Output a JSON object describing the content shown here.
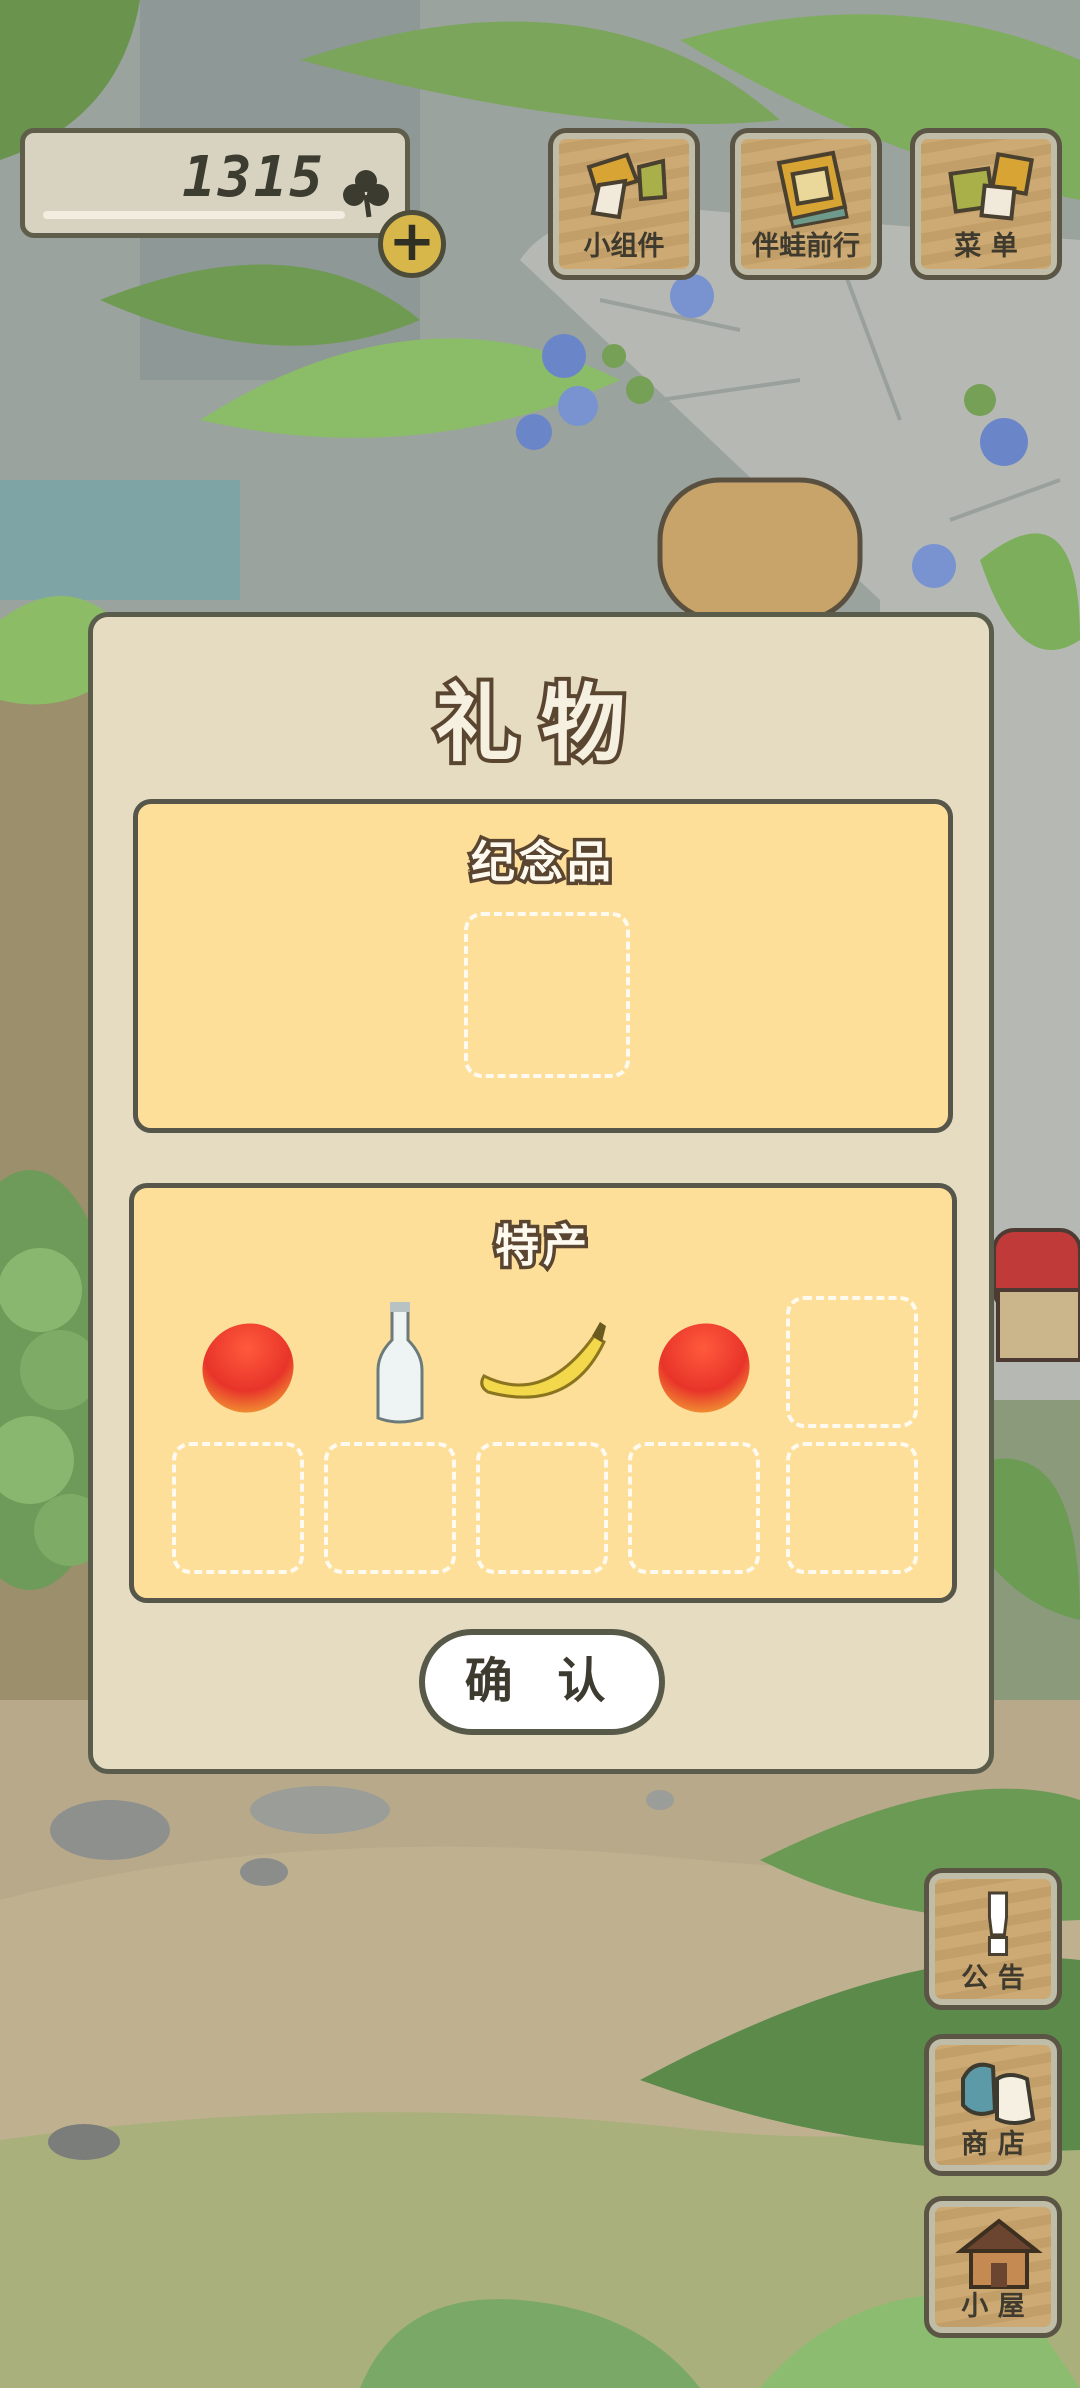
{
  "currency": {
    "amount": "1315",
    "icon": "clover-icon",
    "add_icon": "+"
  },
  "top_menu": {
    "widgets_label": "小组件",
    "travel_label": "伴蛙前行",
    "menu_label": "菜 单"
  },
  "side_menu": {
    "notice_label": "公 告",
    "shop_label": "商 店",
    "house_label": "小 屋",
    "notice_icon": "!"
  },
  "gift_dialog": {
    "title": "礼物",
    "souvenir": {
      "label": "纪念品",
      "items": []
    },
    "specialty": {
      "label": "特产",
      "items": [
        "mango-icon",
        "bottle-icon",
        "banana-icon",
        "mango-icon"
      ],
      "slot_count": 10
    },
    "confirm_label": "确 认"
  },
  "colors": {
    "panel": "#fddf99",
    "dialog": "#e5dcc2",
    "outline": "#5a5d4c",
    "coin": "#d7b74a"
  }
}
